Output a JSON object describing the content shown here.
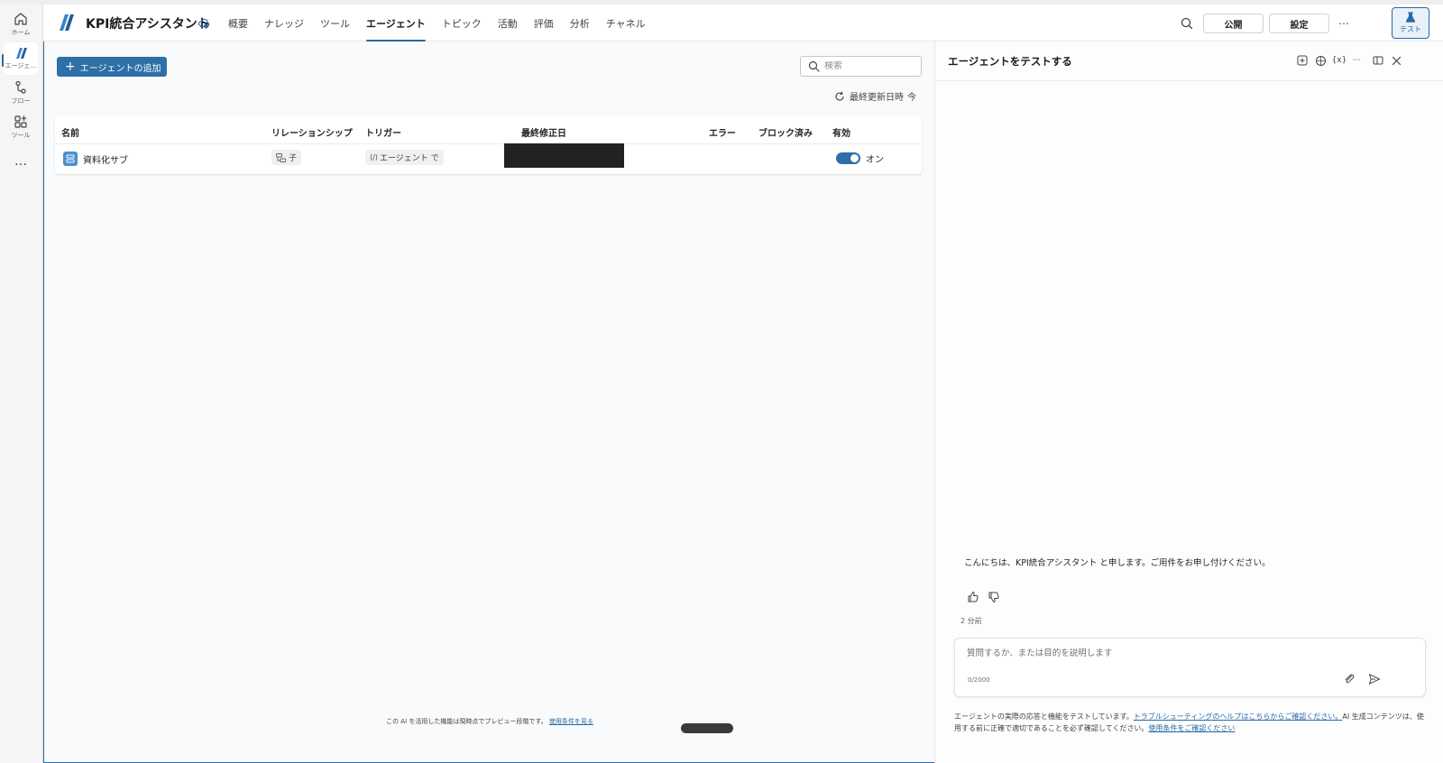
{
  "rail": {
    "home_label": "ホーム",
    "agents_label": "エージェ…",
    "flows_label": "フロー",
    "tools_label": "ツール",
    "more_label": "…"
  },
  "header": {
    "app_title": "KPI統合アシスタント",
    "nav": [
      "概要",
      "ナレッジ",
      "ツール",
      "エージェント",
      "トピック",
      "活動",
      "評価",
      "分析",
      "チャネル"
    ],
    "active_nav": "エージェント",
    "publish_label": "公開",
    "settings_label": "設定",
    "more_label": "⋯",
    "test_label": "テスト"
  },
  "toolbar": {
    "add_agent_label": "エージェントの追加",
    "search_placeholder": "検索",
    "refresh_label": "最終更新日時",
    "refresh_value": "今"
  },
  "table": {
    "columns": [
      "名前",
      "リレーションシップ",
      "トリガー",
      "最終修正日",
      "エラー",
      "ブロック済み",
      "有効"
    ],
    "rows": [
      {
        "name": "資料化サブ",
        "relationship": "子",
        "trigger": "エージェント で",
        "enabled_label": "オン",
        "enabled": true
      }
    ]
  },
  "footer": {
    "note": "この AI を活用した機能は現時点でプレビュー段階です。",
    "terms_link": "使用条件を見る"
  },
  "test_panel": {
    "title": "エージェントをテストする",
    "greeting": "こんにちは、KPI統合アシスタント と申します。ご用件をお申し付けください。",
    "time": "2 分前",
    "input_placeholder": "質問するか、または目的を説明します",
    "counter": "0/2000",
    "disclaimer_text_1": "エージェントの実際の応答と機能をテストしています。",
    "disclaimer_link_1": "トラブルシューティングのヘルプはこちらからご確認ください。",
    "disclaimer_text_2": "AI 生成コンテンツは、使用する前に正確で適切であることを必ず確認してください。",
    "disclaimer_link_2": "使用条件をご確認ください"
  },
  "colors": {
    "accent": "#2b6aa3",
    "button_primary": "#2e6fa7",
    "redaction": "#222222"
  }
}
